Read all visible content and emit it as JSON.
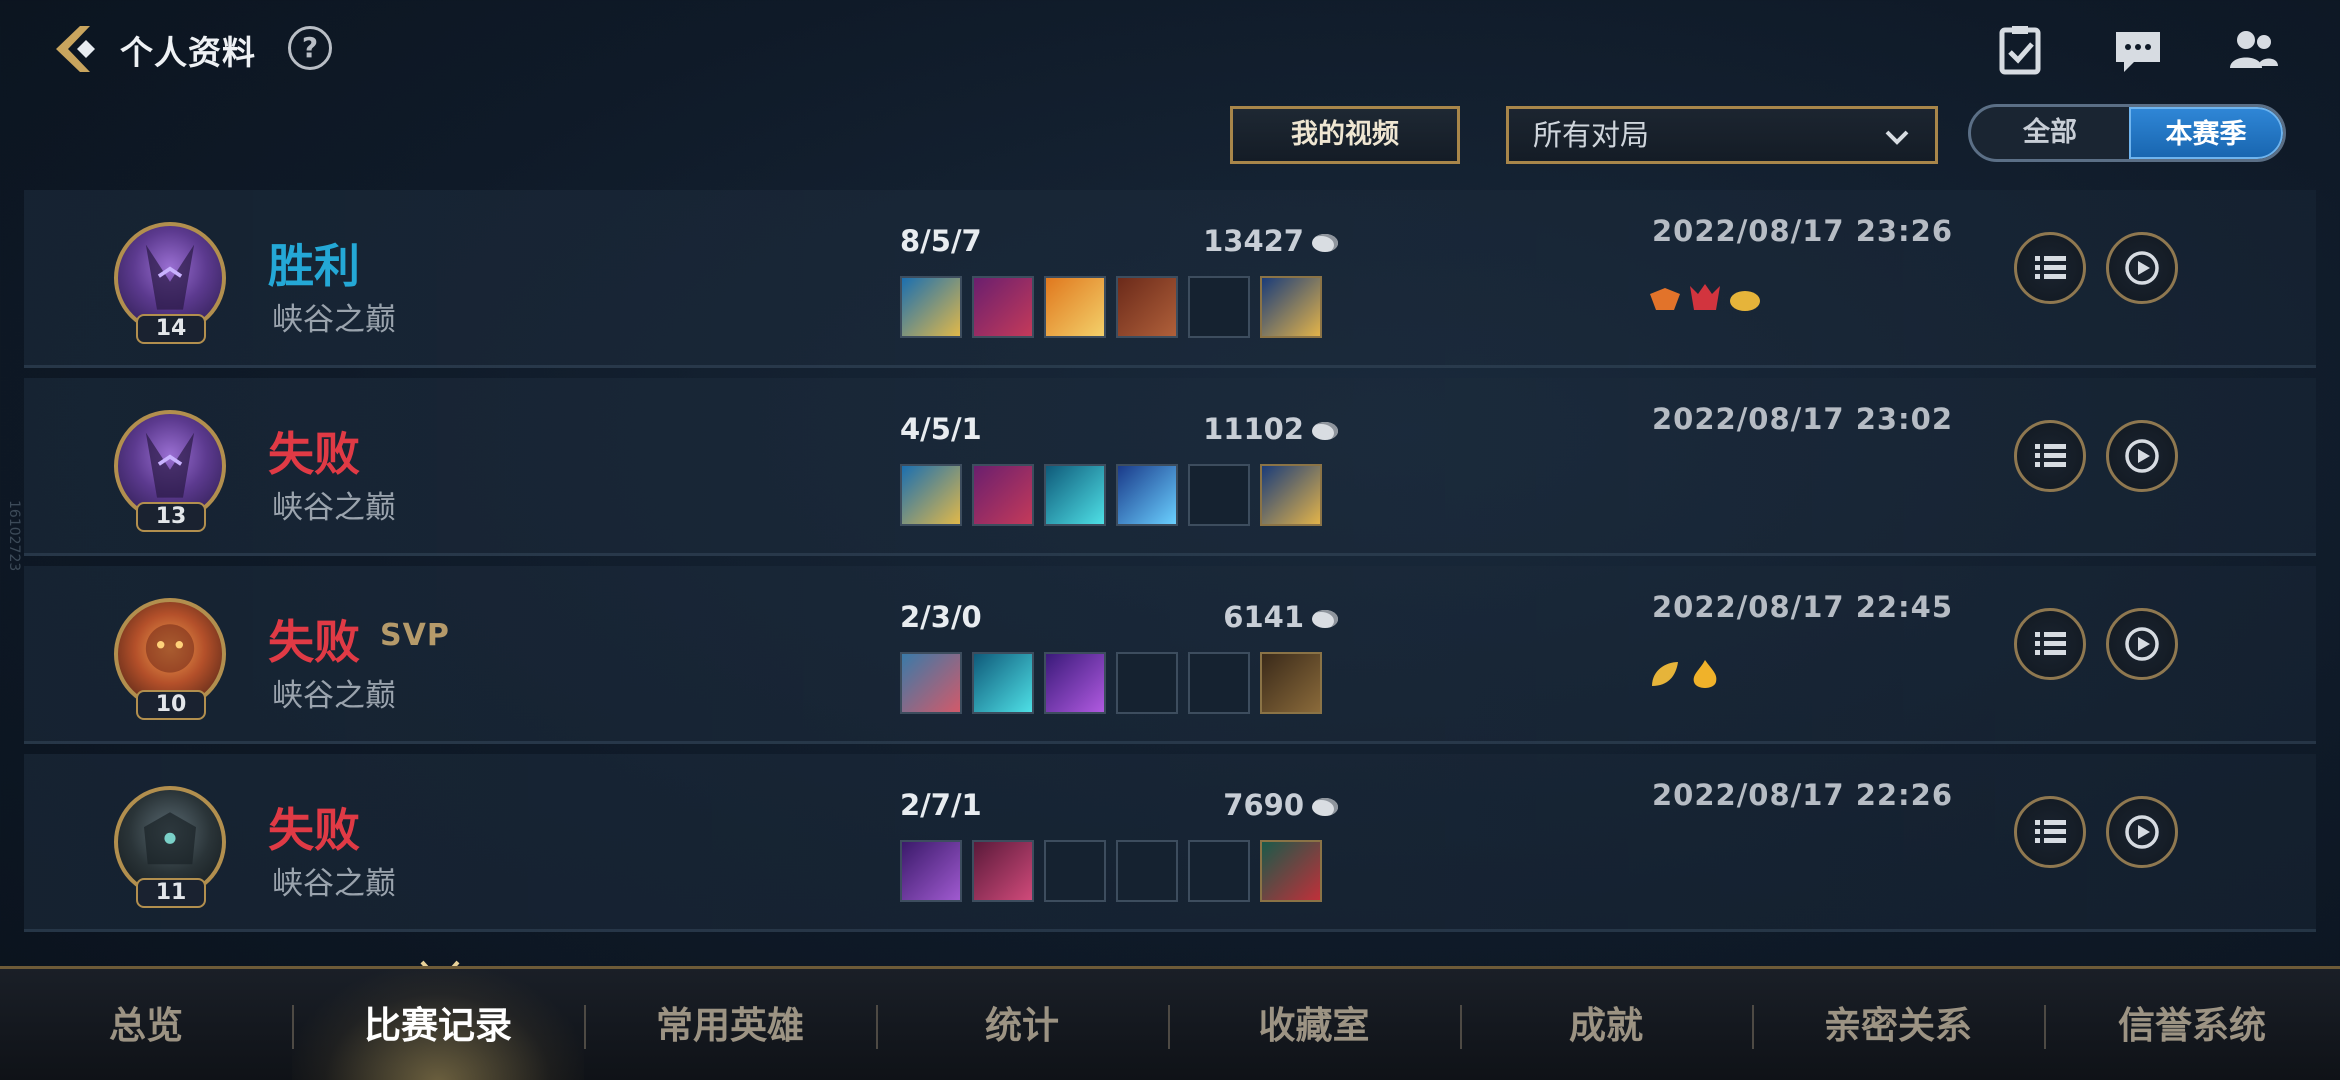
{
  "header": {
    "title": "个人资料",
    "help": "?"
  },
  "controls": {
    "my_videos": "我的视频",
    "filter_selected": "所有对局",
    "segment": {
      "all": "全部",
      "season": "本赛季",
      "selected": "本赛季"
    }
  },
  "side_text": "16102723",
  "matches": [
    {
      "result": "胜利",
      "result_type": "win",
      "svp": "",
      "mode": "峡谷之巅",
      "level": "14",
      "kda": "8/5/7",
      "gold": "13427",
      "datetime": "2022/08/17 23:26",
      "badges": [
        "triple-kill-badge",
        "demon-badge",
        "gold-badge"
      ]
    },
    {
      "result": "失败",
      "result_type": "loss",
      "svp": "",
      "mode": "峡谷之巅",
      "level": "13",
      "kda": "4/5/1",
      "gold": "11102",
      "datetime": "2022/08/17 23:02",
      "badges": []
    },
    {
      "result": "失败",
      "result_type": "loss",
      "svp": "SVP",
      "mode": "峡谷之巅",
      "level": "10",
      "kda": "2/3/0",
      "gold": "6141",
      "datetime": "2022/08/17 22:45",
      "badges": [
        "leaf-badge",
        "flame-badge"
      ]
    },
    {
      "result": "失败",
      "result_type": "loss",
      "svp": "",
      "mode": "峡谷之巅",
      "level": "11",
      "kda": "2/7/1",
      "gold": "7690",
      "datetime": "2022/08/17 22:26",
      "badges": []
    }
  ],
  "bottom_nav": [
    "总览",
    "比赛记录",
    "常用英雄",
    "统计",
    "收藏室",
    "成就",
    "亲密关系",
    "信誉系统"
  ],
  "bottom_nav_active": "比赛记录",
  "colors": {
    "win": "#24a8d6",
    "loss": "#e03a45",
    "gold_border": "#a8864a",
    "accent_blue": "#2f86d6"
  }
}
